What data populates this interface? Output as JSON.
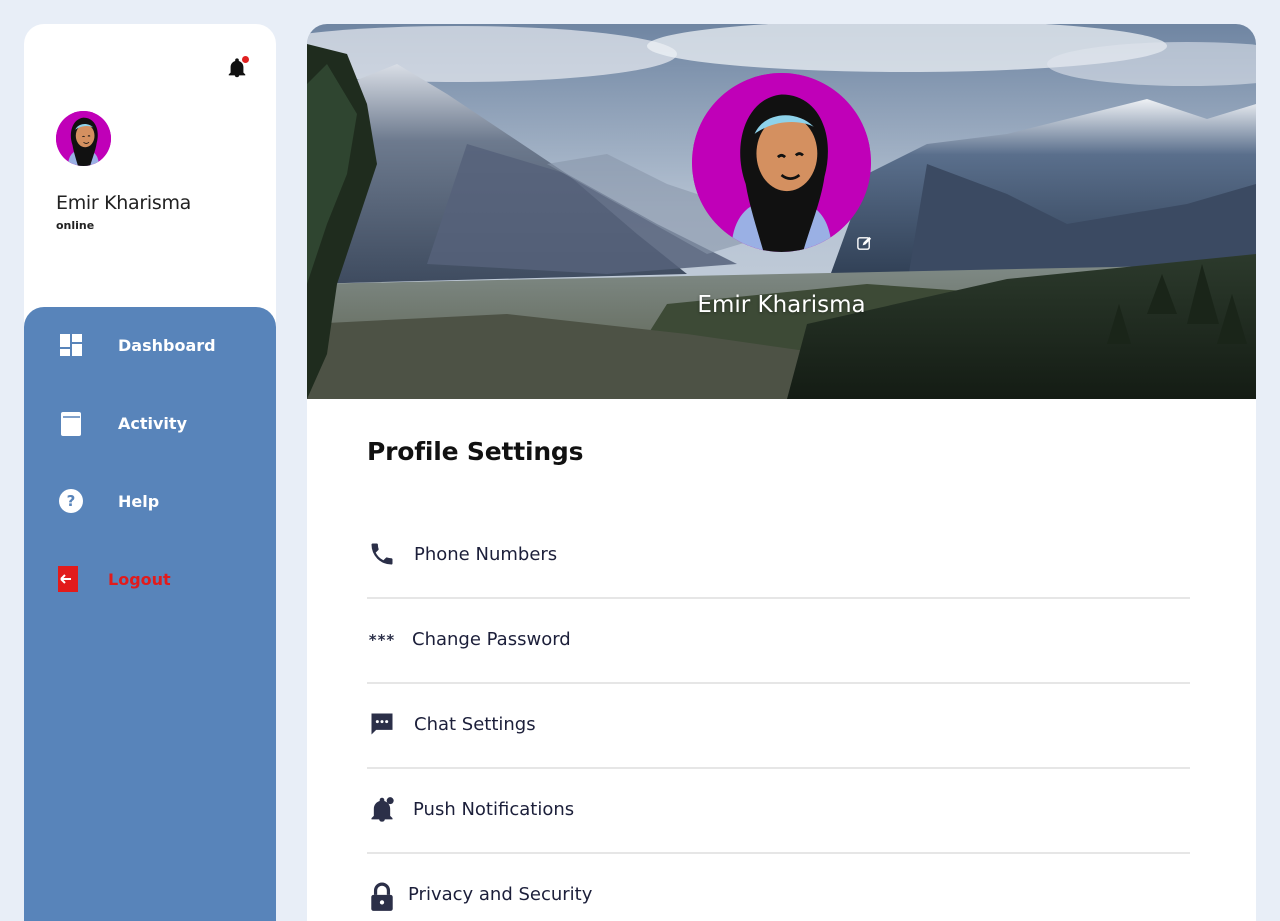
{
  "sidebar": {
    "user_name": "Emir Kharisma",
    "user_status": "online",
    "nav": [
      {
        "label": "Dashboard",
        "icon": "dashboard-icon"
      },
      {
        "label": "Activity",
        "icon": "book-icon"
      },
      {
        "label": "Help",
        "icon": "help-icon"
      },
      {
        "label": "Logout",
        "icon": "logout-icon"
      }
    ],
    "notification_indicator_color": "#e02020"
  },
  "profile": {
    "name": "Emir Kharisma",
    "avatar_bg": "#c000b8"
  },
  "settings": {
    "title": "Profile Settings",
    "items": [
      {
        "label": "Phone Numbers",
        "icon": "phone-icon"
      },
      {
        "label": "Change Password",
        "icon": "asterisks-icon",
        "glyph": "***"
      },
      {
        "label": "Chat Settings",
        "icon": "chat-icon"
      },
      {
        "label": "Push Notifications",
        "icon": "bell-icon"
      },
      {
        "label": "Privacy and Security",
        "icon": "lock-icon"
      }
    ]
  },
  "colors": {
    "page_bg": "#e8eef7",
    "nav_bg": "#5884ba",
    "logout": "#e21b1b",
    "text_dark": "#1c1f3a"
  }
}
